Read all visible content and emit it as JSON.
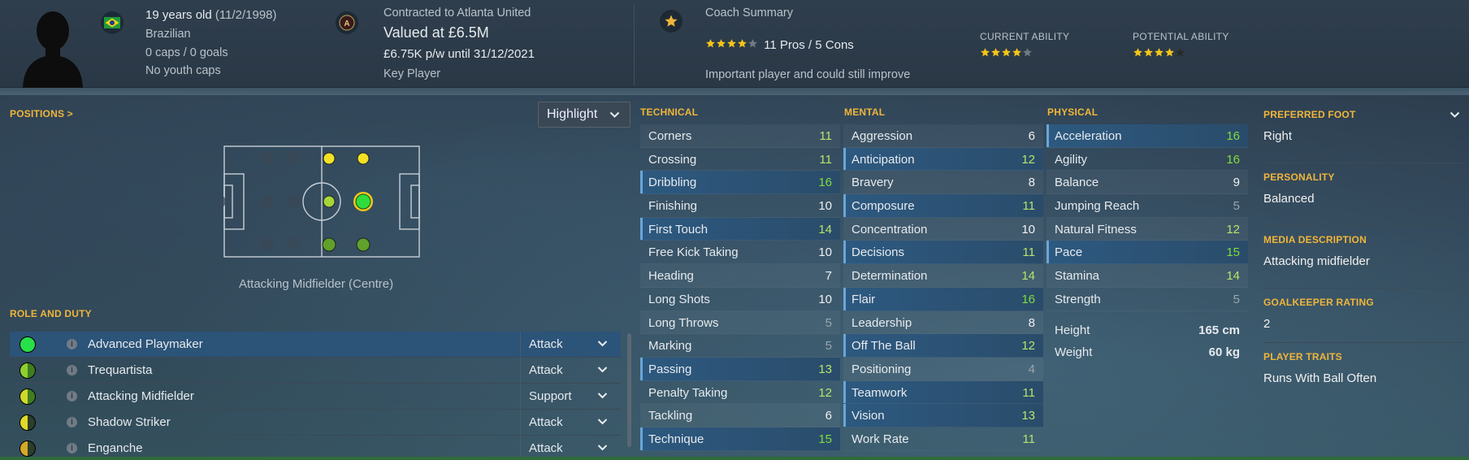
{
  "header": {
    "age": "19 years old",
    "dob": "(11/2/1998)",
    "nationality": "Brazilian",
    "caps": "0 caps / 0 goals",
    "youth_caps": "No youth caps",
    "contract": "Contracted to Atlanta United",
    "value": "Valued at £6.5M",
    "wage": "£6.75K p/w until 31/12/2021",
    "squad_status": "Key Player",
    "coach_summary_title": "Coach Summary",
    "pros_cons": "11 Pros / 5 Cons",
    "summary_text": "Important player and could still improve",
    "current_ability_label": "CURRENT ABILITY",
    "potential_ability_label": "POTENTIAL ABILITY",
    "summary_stars": 4,
    "current_ability_stars": 4,
    "potential_ability_stars": 4,
    "club_badge_letter": "A",
    "colors": {
      "star": "#f5c518",
      "gold": "#f0b53a",
      "flag_green": "#1e9a3c",
      "flag_yellow": "#f7d21a",
      "flag_blue": "#1d3c8c"
    }
  },
  "positions": {
    "title": "POSITIONS >",
    "highlight_label": "Highlight",
    "current_position": "Attacking Midfielder (Centre)"
  },
  "roles": {
    "title": "ROLE AND DUTY",
    "items": [
      {
        "name": "Advanced Playmaker",
        "duty": "Attack",
        "selected": true,
        "icon_color": "#28e04a"
      },
      {
        "name": "Trequartista",
        "duty": "Attack",
        "selected": false,
        "icon_color": "#9fd230"
      },
      {
        "name": "Attacking Midfielder",
        "duty": "Support",
        "selected": false,
        "icon_color": "#c6d52a"
      },
      {
        "name": "Shadow Striker",
        "duty": "Attack",
        "selected": false,
        "icon_color": "#d6d62a"
      },
      {
        "name": "Enganche",
        "duty": "Attack",
        "selected": false,
        "icon_color": "#d2a928"
      }
    ]
  },
  "technical": {
    "title": "TECHNICAL",
    "items": [
      {
        "name": "Corners",
        "value": "11",
        "hl": false
      },
      {
        "name": "Crossing",
        "value": "11",
        "hl": false
      },
      {
        "name": "Dribbling",
        "value": "16",
        "hl": true
      },
      {
        "name": "Finishing",
        "value": "10",
        "hl": false
      },
      {
        "name": "First Touch",
        "value": "14",
        "hl": true
      },
      {
        "name": "Free Kick Taking",
        "value": "10",
        "hl": false
      },
      {
        "name": "Heading",
        "value": "7",
        "hl": false
      },
      {
        "name": "Long Shots",
        "value": "10",
        "hl": false
      },
      {
        "name": "Long Throws",
        "value": "5",
        "hl": false
      },
      {
        "name": "Marking",
        "value": "5",
        "hl": false
      },
      {
        "name": "Passing",
        "value": "13",
        "hl": true
      },
      {
        "name": "Penalty Taking",
        "value": "12",
        "hl": false
      },
      {
        "name": "Tackling",
        "value": "6",
        "hl": false
      },
      {
        "name": "Technique",
        "value": "15",
        "hl": true
      }
    ]
  },
  "mental": {
    "title": "MENTAL",
    "items": [
      {
        "name": "Aggression",
        "value": "6",
        "hl": false
      },
      {
        "name": "Anticipation",
        "value": "12",
        "hl": true
      },
      {
        "name": "Bravery",
        "value": "8",
        "hl": false
      },
      {
        "name": "Composure",
        "value": "11",
        "hl": true
      },
      {
        "name": "Concentration",
        "value": "10",
        "hl": false
      },
      {
        "name": "Decisions",
        "value": "11",
        "hl": true
      },
      {
        "name": "Determination",
        "value": "14",
        "hl": false
      },
      {
        "name": "Flair",
        "value": "16",
        "hl": true
      },
      {
        "name": "Leadership",
        "value": "8",
        "hl": false
      },
      {
        "name": "Off The Ball",
        "value": "12",
        "hl": true
      },
      {
        "name": "Positioning",
        "value": "4",
        "hl": false
      },
      {
        "name": "Teamwork",
        "value": "11",
        "hl": true
      },
      {
        "name": "Vision",
        "value": "13",
        "hl": true
      },
      {
        "name": "Work Rate",
        "value": "11",
        "hl": false
      }
    ]
  },
  "physical": {
    "title": "PHYSICAL",
    "items": [
      {
        "name": "Acceleration",
        "value": "16",
        "hl": true
      },
      {
        "name": "Agility",
        "value": "16",
        "hl": false
      },
      {
        "name": "Balance",
        "value": "9",
        "hl": false
      },
      {
        "name": "Jumping Reach",
        "value": "5",
        "hl": false
      },
      {
        "name": "Natural Fitness",
        "value": "12",
        "hl": false
      },
      {
        "name": "Pace",
        "value": "15",
        "hl": true
      },
      {
        "name": "Stamina",
        "value": "14",
        "hl": false
      },
      {
        "name": "Strength",
        "value": "5",
        "hl": false
      }
    ],
    "height_label": "Height",
    "height_value": "165 cm",
    "weight_label": "Weight",
    "weight_value": "60 kg"
  },
  "info": [
    {
      "label": "PREFERRED FOOT",
      "value": "Right"
    },
    {
      "label": "PERSONALITY",
      "value": "Balanced"
    },
    {
      "label": "MEDIA DESCRIPTION",
      "value": "Attacking midfielder"
    },
    {
      "label": "GOALKEEPER RATING",
      "value": "2"
    },
    {
      "label": "PLAYER TRAITS",
      "value": "Runs With Ball Often"
    }
  ]
}
